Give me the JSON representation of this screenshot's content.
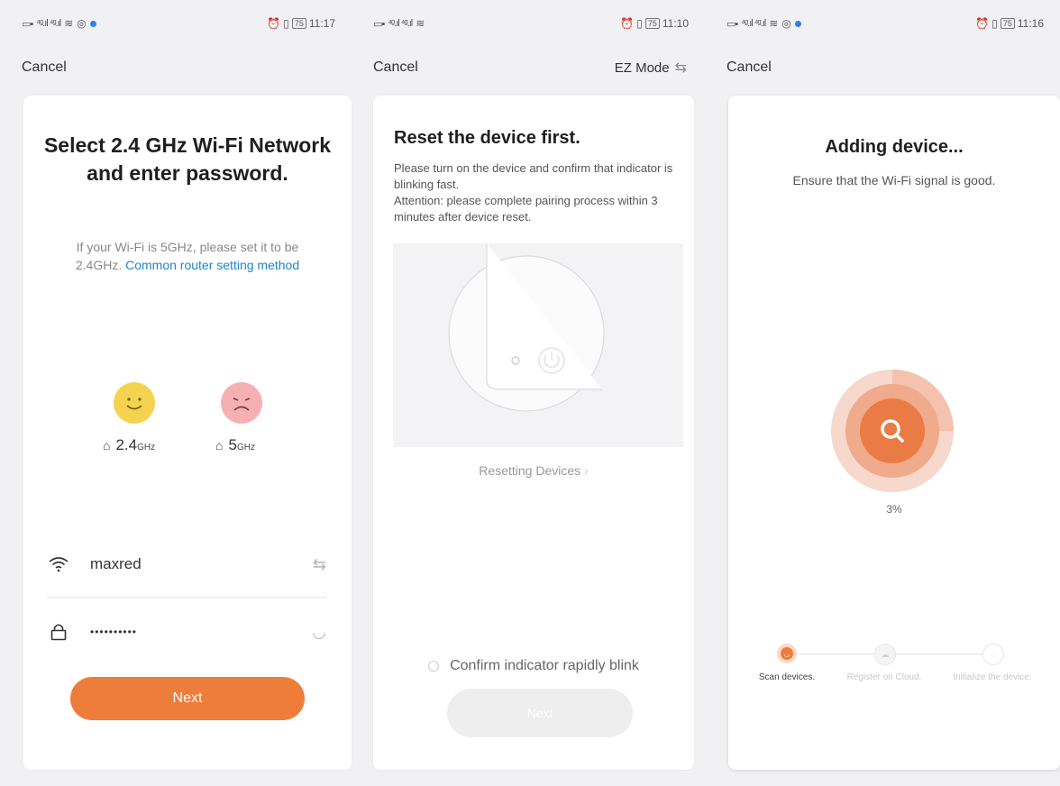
{
  "screens": [
    {
      "status": {
        "time": "11:17",
        "battery": "75"
      },
      "cancel": "Cancel",
      "title": "Select 2.4 GHz Wi-Fi Network and enter password.",
      "desc": "If your Wi-Fi is 5GHz, please set it to be 2.4GHz.",
      "link": "Common router setting method",
      "bands": [
        {
          "value": "2.4",
          "unit": "GHz"
        },
        {
          "value": "5",
          "unit": "GHz"
        }
      ],
      "wifi_name": "maxred",
      "password_mask": "••••••••••",
      "next": "Next"
    },
    {
      "status": {
        "time": "11:10",
        "battery": "75"
      },
      "cancel": "Cancel",
      "mode": "EZ Mode",
      "title": "Reset the device first.",
      "desc1": "Please turn on the device and confirm that indicator is blinking fast.",
      "desc2": "Attention: please complete pairing process within 3 minutes after device reset.",
      "reset_link": "Resetting Devices",
      "confirm": "Confirm indicator rapidly blink",
      "next": "Next"
    },
    {
      "status": {
        "time": "11:16",
        "battery": "75"
      },
      "cancel": "Cancel",
      "title": "Adding device...",
      "subtitle": "Ensure that the Wi-Fi signal is good.",
      "progress": "3%",
      "steps": [
        {
          "label": "Scan devices."
        },
        {
          "label": "Register on Cloud."
        },
        {
          "label": "Initialize the device."
        }
      ]
    }
  ],
  "colors": {
    "accent": "#ee7d3c",
    "link": "#1d86c8",
    "happy": "#f5d34f",
    "sad": "#f6b0b3"
  }
}
